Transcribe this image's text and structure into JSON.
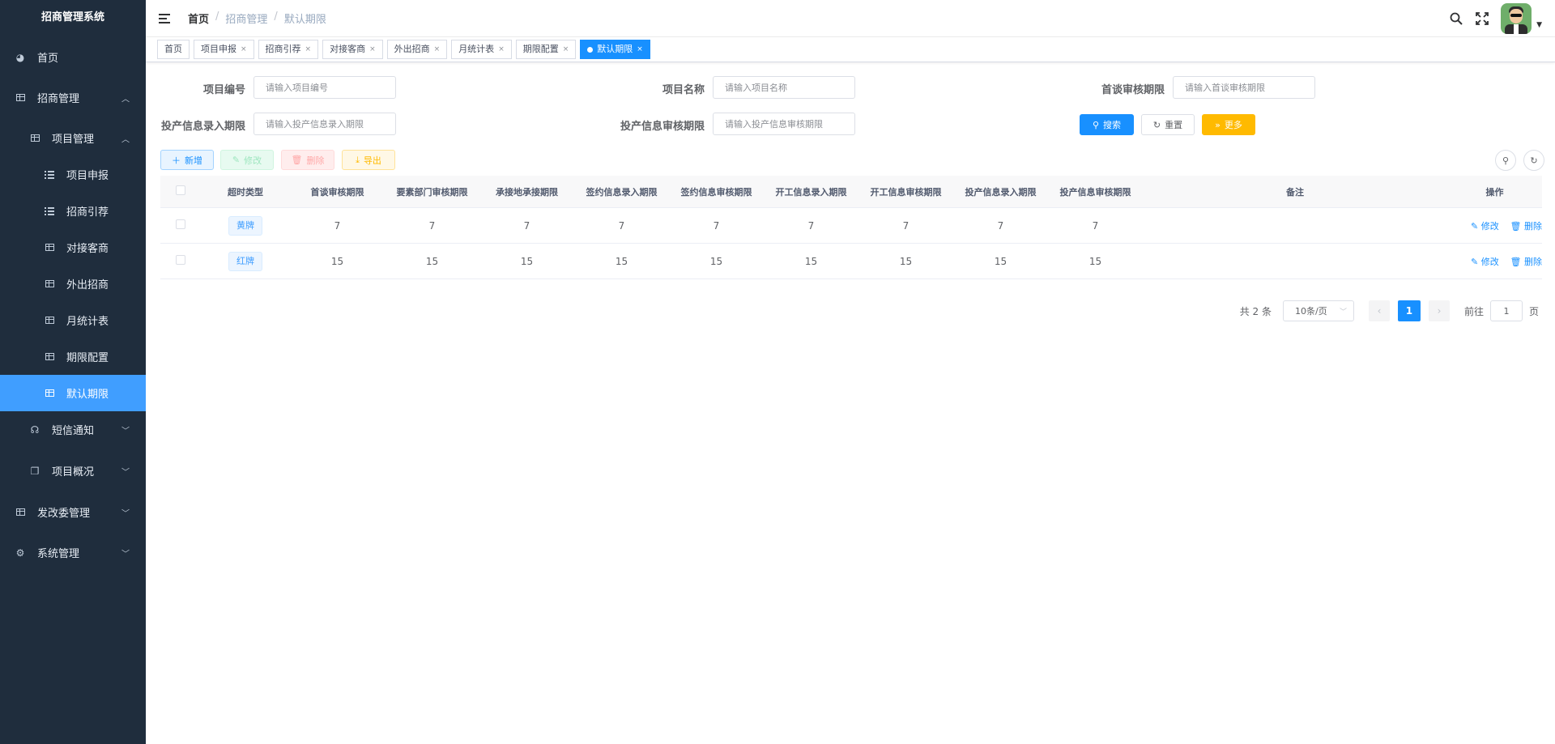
{
  "sidebar": {
    "logo": "招商管理系统",
    "items": [
      {
        "label": "首页"
      },
      {
        "label": "招商管理"
      },
      {
        "label": "项目管理"
      },
      {
        "label": "项目申报"
      },
      {
        "label": "招商引荐"
      },
      {
        "label": "对接客商"
      },
      {
        "label": "外出招商"
      },
      {
        "label": "月统计表"
      },
      {
        "label": "期限配置"
      },
      {
        "label": "默认期限"
      },
      {
        "label": "短信通知"
      },
      {
        "label": "项目概况"
      },
      {
        "label": "发改委管理"
      },
      {
        "label": "系统管理"
      }
    ]
  },
  "header": {
    "breadcrumb": [
      "首页",
      "招商管理",
      "默认期限"
    ]
  },
  "tags": [
    "首页",
    "项目申报",
    "招商引荐",
    "对接客商",
    "外出招商",
    "月统计表",
    "期限配置",
    "默认期限"
  ],
  "search": {
    "fields": [
      {
        "label": "项目编号",
        "placeholder": "请输入项目编号"
      },
      {
        "label": "项目名称",
        "placeholder": "请输入项目名称"
      },
      {
        "label": "首谈审核期限",
        "placeholder": "请输入首谈审核期限"
      },
      {
        "label": "投产信息录入期限",
        "placeholder": "请输入投产信息录入期限"
      },
      {
        "label": "投产信息审核期限",
        "placeholder": "请输入投产信息审核期限"
      }
    ],
    "search_label": "搜索",
    "reset_label": "重置",
    "more_label": "更多"
  },
  "toolbar": {
    "add_label": "新增",
    "edit_label": "修改",
    "delete_label": "删除",
    "export_label": "导出"
  },
  "table": {
    "columns": [
      "超时类型",
      "首谈审核期限",
      "要素部门审核期限",
      "承接地承接期限",
      "签约信息录入期限",
      "签约信息审核期限",
      "开工信息录入期限",
      "开工信息审核期限",
      "投产信息录入期限",
      "投产信息审核期限",
      "备注",
      "操作"
    ],
    "rows": [
      {
        "type": "黄牌",
        "values": [
          "7",
          "7",
          "7",
          "7",
          "7",
          "7",
          "7",
          "7",
          "7"
        ],
        "remark": ""
      },
      {
        "type": "红牌",
        "values": [
          "15",
          "15",
          "15",
          "15",
          "15",
          "15",
          "15",
          "15",
          "15"
        ],
        "remark": ""
      }
    ],
    "edit_label": "修改",
    "delete_label": "删除"
  },
  "pagination": {
    "total_text": "共 2 条",
    "page_size": "10条/页",
    "current_page": "1",
    "goto_label": "前往",
    "goto_value": "1",
    "page_suffix": "页"
  },
  "colors": {
    "sidebar_bg": "#1f2d3d",
    "primary": "#1890ff",
    "active_menu": "#409eff",
    "warning": "#ffba00"
  }
}
